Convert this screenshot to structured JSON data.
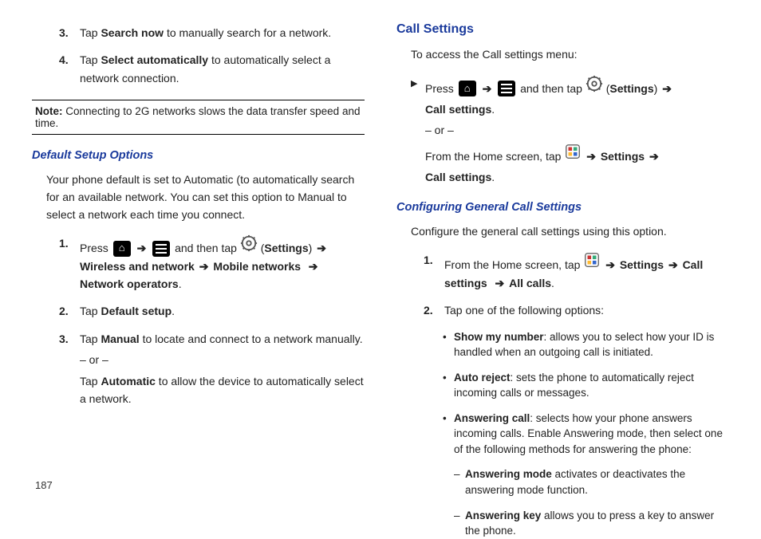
{
  "pageNumber": "187",
  "left": {
    "step3": {
      "num": "3.",
      "pre": "Tap ",
      "bold": "Search now",
      "post": " to manually search for a network."
    },
    "step4": {
      "num": "4.",
      "pre": "Tap ",
      "bold": "Select automatically",
      "post": " to automatically select a network connection."
    },
    "noteLabel": "Note:",
    "noteText": " Connecting to 2G networks slows the data transfer speed and time.",
    "heading1": "Default Setup Options",
    "para1": "Your phone default is set to Automatic (to automatically search for an available network. You can set this option to Manual to select a network each time you connect.",
    "d1": {
      "num": "1.",
      "press": "Press ",
      "andthen": " and then tap ",
      "settingsParen": "Settings",
      "bold2a": "Wireless and network",
      "bold2b": "Mobile networks",
      "bold2c": "Network operators"
    },
    "d2": {
      "num": "2.",
      "pre": "Tap ",
      "bold": "Default setup",
      "post": "."
    },
    "d3": {
      "num": "3.",
      "pre": "Tap ",
      "bold": "Manual",
      "post": " to locate and connect to a network manually.",
      "or": "– or –",
      "pre2": "Tap ",
      "bold2": "Automatic",
      "post2": " to allow the device to automatically select a network."
    }
  },
  "right": {
    "heading": "Call Settings",
    "intro": "To access the Call settings menu:",
    "row1": {
      "press": "Press ",
      "andthen": " and then tap ",
      "settingsParen": "Settings",
      "callsettings": "Call settings",
      "or": "– or –",
      "fromhome": "From the Home screen, tap ",
      "settings": "Settings",
      "callsettings2": "Call settings"
    },
    "heading2": "Configuring General Call Settings",
    "para2": "Configure the general call settings using this option.",
    "c1": {
      "num": "1.",
      "fromhome": "From the Home screen, tap ",
      "settings": "Settings",
      "callsettings": "Call settings",
      "allcalls": "All calls"
    },
    "c2": {
      "num": "2.",
      "text": "Tap one of the following options:"
    },
    "b1": {
      "bold": "Show my number",
      "rest": ": allows you to select how your ID is handled when an outgoing call is initiated."
    },
    "b2": {
      "bold": "Auto reject",
      "rest": ": sets the phone to automatically reject incoming calls or messages."
    },
    "b3": {
      "bold": "Answering call",
      "rest": ": selects how your phone answers incoming calls. Enable Answering mode, then select one of the following methods for answering the phone:"
    },
    "d1": {
      "bold": "Answering mode",
      "rest": " activates or deactivates the answering mode function."
    },
    "d2": {
      "bold": "Answering key",
      "rest": " allows you to press a key to answer the phone."
    }
  },
  "arrow": "➔"
}
